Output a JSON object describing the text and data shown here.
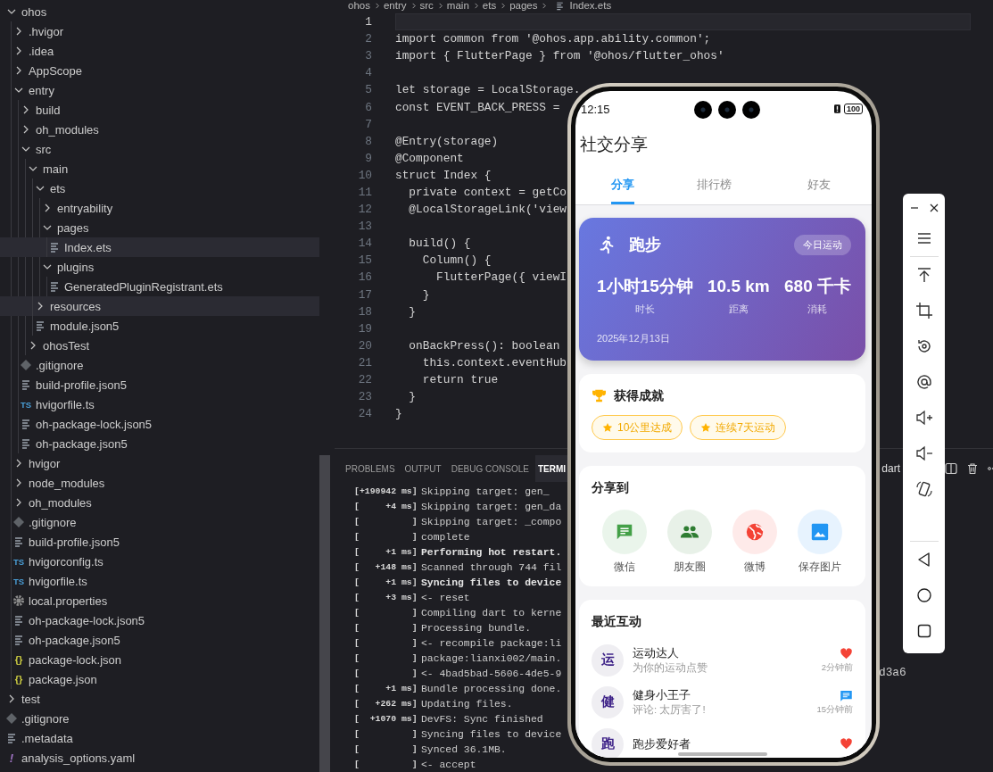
{
  "explorer": {
    "tree": [
      {
        "name": "ohos",
        "kind": "folder",
        "expanded": true,
        "selected": false,
        "children": [
          {
            "name": ".hvigor",
            "kind": "folder",
            "expanded": false,
            "selected": false
          },
          {
            "name": ".idea",
            "kind": "folder",
            "expanded": false,
            "selected": false
          },
          {
            "name": "AppScope",
            "kind": "folder",
            "expanded": false,
            "selected": false
          },
          {
            "name": "entry",
            "kind": "folder",
            "expanded": true,
            "selected": false,
            "children": [
              {
                "name": "build",
                "kind": "folder",
                "expanded": false,
                "selected": false
              },
              {
                "name": "oh_modules",
                "kind": "folder",
                "expanded": false,
                "selected": false
              },
              {
                "name": "src",
                "kind": "folder",
                "expanded": true,
                "selected": false,
                "children": [
                  {
                    "name": "main",
                    "kind": "folder",
                    "expanded": true,
                    "selected": false,
                    "children": [
                      {
                        "name": "ets",
                        "kind": "folder",
                        "expanded": true,
                        "selected": false,
                        "children": [
                          {
                            "name": "entryability",
                            "kind": "folder",
                            "expanded": false,
                            "selected": false
                          },
                          {
                            "name": "pages",
                            "kind": "folder",
                            "expanded": true,
                            "selected": false,
                            "children": [
                              {
                                "name": "Index.ets",
                                "kind": "file",
                                "selected": true
                              }
                            ]
                          },
                          {
                            "name": "plugins",
                            "kind": "folder",
                            "expanded": true,
                            "selected": false,
                            "children": [
                              {
                                "name": "GeneratedPluginRegistrant.ets",
                                "kind": "file",
                                "selected": false
                              }
                            ]
                          }
                        ]
                      },
                      {
                        "name": "resources",
                        "kind": "folder",
                        "expanded": false,
                        "selected": true
                      },
                      {
                        "name": "module.json5",
                        "kind": "file",
                        "selected": false
                      }
                    ]
                  },
                  {
                    "name": "ohosTest",
                    "kind": "folder",
                    "expanded": false,
                    "selected": false
                  }
                ]
              },
              {
                "name": ".gitignore",
                "kind": "git",
                "selected": false
              },
              {
                "name": "build-profile.json5",
                "kind": "file",
                "selected": false
              },
              {
                "name": "hvigorfile.ts",
                "kind": "ts",
                "glyph": "TS",
                "selected": false
              },
              {
                "name": "oh-package-lock.json5",
                "kind": "file",
                "selected": false
              },
              {
                "name": "oh-package.json5",
                "kind": "file",
                "selected": false
              }
            ]
          },
          {
            "name": "hvigor",
            "kind": "folder",
            "expanded": false,
            "selected": false
          },
          {
            "name": "node_modules",
            "kind": "folder",
            "expanded": false,
            "selected": false
          },
          {
            "name": "oh_modules",
            "kind": "folder",
            "expanded": false,
            "selected": false
          },
          {
            "name": ".gitignore",
            "kind": "git",
            "selected": false
          },
          {
            "name": "build-profile.json5",
            "kind": "file",
            "selected": false
          },
          {
            "name": "hvigorconfig.ts",
            "kind": "ts",
            "glyph": "TS",
            "selected": false
          },
          {
            "name": "hvigorfile.ts",
            "kind": "ts",
            "glyph": "TS",
            "selected": false
          },
          {
            "name": "local.properties",
            "kind": "gear",
            "selected": false
          },
          {
            "name": "oh-package-lock.json5",
            "kind": "file",
            "selected": false
          },
          {
            "name": "oh-package.json5",
            "kind": "file",
            "selected": false
          },
          {
            "name": "package-lock.json",
            "kind": "json",
            "glyph": "{}",
            "selected": false
          },
          {
            "name": "package.json",
            "kind": "json",
            "glyph": "{}",
            "selected": false
          }
        ]
      },
      {
        "name": "test",
        "kind": "folder",
        "expanded": false,
        "selected": false
      },
      {
        "name": ".gitignore",
        "kind": "git",
        "selected": false
      },
      {
        "name": ".metadata",
        "kind": "file",
        "selected": false
      },
      {
        "name": "analysis_options.yaml",
        "kind": "yaml",
        "glyph": "!",
        "selected": false
      }
    ]
  },
  "editor": {
    "breadcrumb": [
      "ohos",
      "entry",
      "src",
      "main",
      "ets",
      "pages",
      "Index.ets"
    ],
    "lines": [
      {
        "number": "1",
        "current": true
      },
      {
        "number": "2",
        "code": "import common from '@ohos.app.ability.common';",
        "current": false
      },
      {
        "number": "3",
        "code": "import { FlutterPage } from '@ohos/flutter_ohos'",
        "current": false
      },
      {
        "number": "4",
        "current": false
      },
      {
        "number": "5",
        "code": "let storage = LocalStorage.",
        "current": false
      },
      {
        "number": "6",
        "code": "const EVENT_BACK_PRESS = ",
        "current": false
      },
      {
        "number": "7",
        "current": false
      },
      {
        "number": "8",
        "code": "@Entry(storage)",
        "current": false
      },
      {
        "number": "9",
        "code": "@Component",
        "current": false
      },
      {
        "number": "10",
        "code": "struct Index {",
        "current": false
      },
      {
        "number": "11",
        "code": "  private context = getCo",
        "current": false
      },
      {
        "number": "12",
        "code": "  @LocalStorageLink('view",
        "current": false
      },
      {
        "number": "13",
        "current": false
      },
      {
        "number": "14",
        "code": "  build() {",
        "current": false
      },
      {
        "number": "15",
        "code": "    Column() {",
        "current": false
      },
      {
        "number": "16",
        "code": "      FlutterPage({ viewI",
        "current": false
      },
      {
        "number": "17",
        "code": "    }",
        "current": false
      },
      {
        "number": "18",
        "code": "  }",
        "current": false
      },
      {
        "number": "19",
        "current": false
      },
      {
        "number": "20",
        "code": "  onBackPress(): boolean",
        "current": false
      },
      {
        "number": "21",
        "code": "    this.context.eventHub",
        "current": false
      },
      {
        "number": "22",
        "code": "    return true",
        "current": false
      },
      {
        "number": "23",
        "code": "  }",
        "current": false
      },
      {
        "number": "24",
        "code": "}",
        "current": false
      }
    ]
  },
  "panel": {
    "tabs": [
      {
        "label": "PROBLEMS",
        "selected": false
      },
      {
        "label": "OUTPUT",
        "selected": false
      },
      {
        "label": "DEBUG CONSOLE",
        "selected": false
      },
      {
        "label": "TERMI",
        "selected": true
      }
    ],
    "terminal_name": "dart",
    "lines": [
      {
        "stamp": "[+190942 ms]",
        "text": "Skipping target: gen_",
        "bold": false
      },
      {
        "stamp": "[     +4 ms]",
        "text": "Skipping target: gen_da",
        "bold": false
      },
      {
        "stamp": "[          ]",
        "text": "Skipping target: _compo",
        "bold": false
      },
      {
        "stamp": "[          ]",
        "text": "complete",
        "bold": false
      },
      {
        "stamp": "[     +1 ms]",
        "text": "Performing hot restart.",
        "bold": true
      },
      {
        "stamp": "[   +148 ms]",
        "text": "Scanned through 744 fil",
        "bold": false
      },
      {
        "stamp": "[     +1 ms]",
        "text": "Syncing files to device",
        "bold": true
      },
      {
        "stamp": "[     +3 ms]",
        "text": "<- reset",
        "bold": false
      },
      {
        "stamp": "[          ]",
        "text": "Compiling dart to kerne",
        "bold": false
      },
      {
        "stamp": "[          ]",
        "text": "Processing bundle.",
        "bold": false
      },
      {
        "stamp": "[          ]",
        "text": "<- recompile package:li",
        "bold": false
      },
      {
        "stamp": "[          ]",
        "text": "package:lianxi002/main.",
        "bold": false
      },
      {
        "stamp": "[          ]",
        "text": "<- 4bad5bad-5606-4de5-9",
        "bold": false
      },
      {
        "stamp": "[     +1 ms]",
        "text": "Bundle processing done.",
        "bold": false
      },
      {
        "stamp": "[   +262 ms]",
        "text": "Updating files.",
        "bold": false
      },
      {
        "stamp": "[  +1070 ms]",
        "text": "DevFS: Sync finished",
        "bold": false
      },
      {
        "stamp": "[          ]",
        "text": "Syncing files to device",
        "bold": false
      },
      {
        "stamp": "[          ]",
        "text": "Synced 36.1MB.",
        "bold": false
      },
      {
        "stamp": "[          ]",
        "text": "<- accept",
        "bold": false
      }
    ],
    "line_tail": "d3a6"
  },
  "phone": {
    "status": {
      "time": "12:15",
      "battery": "100"
    },
    "title": "社交分享",
    "tabs": [
      {
        "label": "分享",
        "selected": true
      },
      {
        "label": "排行榜",
        "selected": false
      },
      {
        "label": "好友",
        "selected": false
      }
    ],
    "activity": {
      "title": "跑步",
      "badge": "今日运动",
      "stats": [
        {
          "value": "1小时15分钟",
          "label": "时长"
        },
        {
          "value": "10.5 km",
          "label": "距离"
        },
        {
          "value": "680 千卡",
          "label": "消耗"
        }
      ],
      "date": "2025年12月13日"
    },
    "achievements": {
      "title": "获得成就",
      "badges": [
        "10公里达成",
        "连续7天运动"
      ]
    },
    "share": {
      "title": "分享到",
      "targets": [
        {
          "label": "微信",
          "kind": "message",
          "color": "#43a047"
        },
        {
          "label": "朋友圈",
          "kind": "people",
          "color": "#2e7d32"
        },
        {
          "label": "微博",
          "kind": "globe",
          "color": "#f44336"
        },
        {
          "label": "保存图片",
          "kind": "image",
          "color": "#2196f3"
        }
      ]
    },
    "recent": {
      "title": "最近互动",
      "items": [
        {
          "avatar": "运",
          "name": "运动达人",
          "detail": "为你的运动点赞",
          "kind": "like",
          "time": "2分钟前"
        },
        {
          "avatar": "健",
          "name": "健身小王子",
          "detail": "评论: 太厉害了!",
          "kind": "comment",
          "time": "15分钟前"
        },
        {
          "avatar": "跑",
          "name": "跑步爱好者",
          "kind": "like"
        }
      ]
    }
  }
}
